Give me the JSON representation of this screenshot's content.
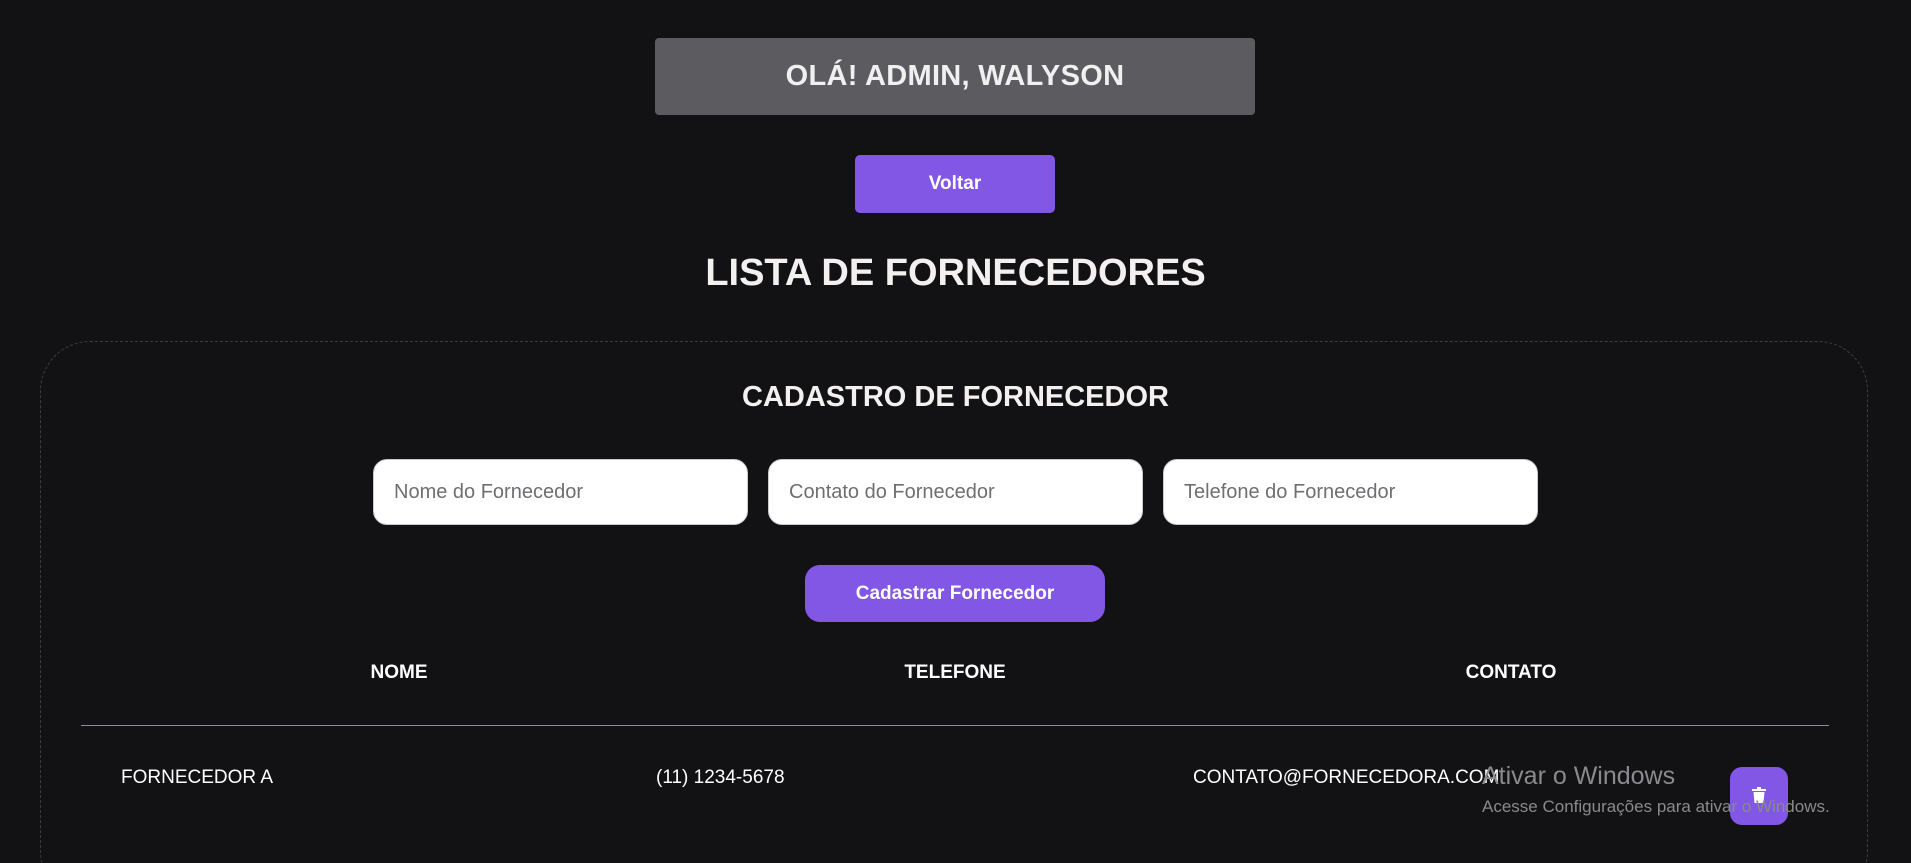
{
  "header": {
    "greeting": "OLÁ! ADMIN, WALYSON",
    "back_label": "Voltar"
  },
  "page_title": "LISTA DE FORNECEDORES",
  "form": {
    "title": "CADASTRO DE FORNECEDOR",
    "fields": [
      {
        "placeholder": "Nome do Fornecedor",
        "value": ""
      },
      {
        "placeholder": "Contato do Fornecedor",
        "value": ""
      },
      {
        "placeholder": "Telefone do Fornecedor",
        "value": ""
      }
    ],
    "submit_label": "Cadastrar Fornecedor"
  },
  "table": {
    "headers": [
      "NOME",
      "TELEFONE",
      "CONTATO"
    ],
    "rows": [
      {
        "nome": "FORNECEDOR A",
        "telefone": "(11) 1234-5678",
        "contato": "CONTATO@FORNECEDORA.COM",
        "action_icon": "trash-icon"
      }
    ]
  },
  "watermark": {
    "title": "Ativar o Windows",
    "subtitle": "Acesse Configurações para ativar o Windows."
  },
  "colors": {
    "background": "#121214",
    "accent": "#8257e5",
    "greeting_bg": "#5b5b60"
  }
}
